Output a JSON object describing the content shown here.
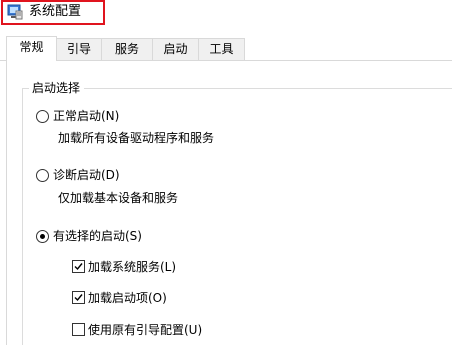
{
  "window": {
    "title": "系统配置",
    "icon": "msconfig-icon",
    "highlight_color": "#e0141e"
  },
  "tabs": [
    {
      "label": "常规",
      "active": true
    },
    {
      "label": "引导",
      "active": false
    },
    {
      "label": "服务",
      "active": false
    },
    {
      "label": "启动",
      "active": false
    },
    {
      "label": "工具",
      "active": false
    }
  ],
  "startup_selection": {
    "group_label": "启动选择",
    "normal": {
      "label": "正常启动(N)",
      "description": "加载所有设备驱动程序和服务",
      "selected": false
    },
    "diagnostic": {
      "label": "诊断启动(D)",
      "description": "仅加载基本设备和服务",
      "selected": false
    },
    "selective": {
      "label": "有选择的启动(S)",
      "selected": true,
      "options": [
        {
          "label": "加载系统服务(L)",
          "checked": true
        },
        {
          "label": "加载启动项(O)",
          "checked": true
        },
        {
          "label": "使用原有引导配置(U)",
          "checked": false
        }
      ]
    }
  }
}
